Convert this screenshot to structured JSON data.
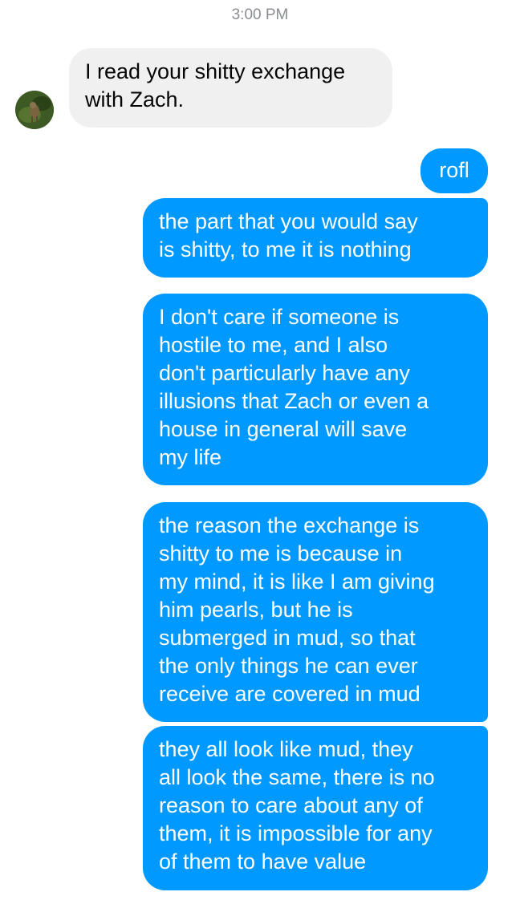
{
  "conversation": {
    "timestamp": "3:00 PM",
    "messages": [
      {
        "sender": "other",
        "text": "I read your shitty exchange\nwith Zach."
      },
      {
        "sender": "me",
        "text": "rofl"
      },
      {
        "sender": "me",
        "text": "the part that you would say\nis shitty, to me it is nothing"
      },
      {
        "sender": "me",
        "text": "I don't care if someone is\nhostile to me, and I also\ndon't particularly have any\nillusions that Zach or even a\nhouse in general will save\nmy life"
      },
      {
        "sender": "me",
        "text": "the reason the exchange is\nshitty to me is because in\nmy mind, it is like I am giving\nhim pearls, but he is\nsubmerged in mud, so that\nthe only things he can ever\nreceive are covered in mud"
      },
      {
        "sender": "me",
        "text": "they all look like mud, they\nall look the same, there is no\nreason to care about any of\nthem, it is impossible for any\nof them to have value"
      }
    ]
  },
  "colors": {
    "outgoing_bubble": "#0099ff",
    "incoming_bubble": "#f0f0f0",
    "timestamp_text": "#8a8d91"
  },
  "icons": {
    "avatar": "contact-avatar-photo"
  }
}
